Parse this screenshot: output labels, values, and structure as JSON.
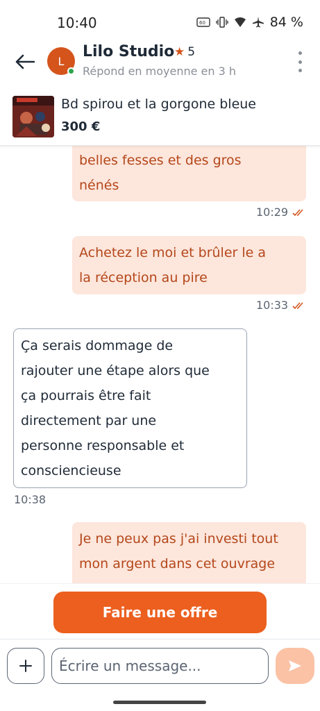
{
  "status_bar": {
    "time": "10:40",
    "battery": "84 %"
  },
  "header": {
    "avatar_letter": "L",
    "seller_name": "Lilo Studio",
    "rating": "5",
    "response_time": "Répond en moyenne en 3 h"
  },
  "product": {
    "title": "Bd spirou et la gorgone bleue",
    "price": "300 €"
  },
  "messages": [
    {
      "direction": "sent",
      "lines": [
        "belles fesses et des gros",
        "nénés"
      ],
      "time": "10:29",
      "read_icon": "double-check-icon"
    },
    {
      "direction": "sent",
      "lines": [
        "Achetez le moi et brûler le a",
        "la réception au pire"
      ],
      "time": "10:33",
      "read_icon": "double-check-icon"
    },
    {
      "direction": "received",
      "lines": [
        "Ça serais dommage de",
        "rajouter une étape alors que",
        "ça pourrais être fait",
        "directement par une",
        "personne responsable et",
        "consciencieuse"
      ],
      "time": "10:38"
    },
    {
      "direction": "sent",
      "lines": [
        "Je ne peux pas j'ai investi tout",
        "mon argent dans cet ouvrage"
      ]
    }
  ],
  "offer_button": "Faire une offre",
  "composer": {
    "placeholder": "Écrire un message..."
  },
  "colors": {
    "accent": "#ec5f1f",
    "sent_bubble": "#fde6dc",
    "sent_text": "#b4471a",
    "online": "#2ea44f"
  }
}
